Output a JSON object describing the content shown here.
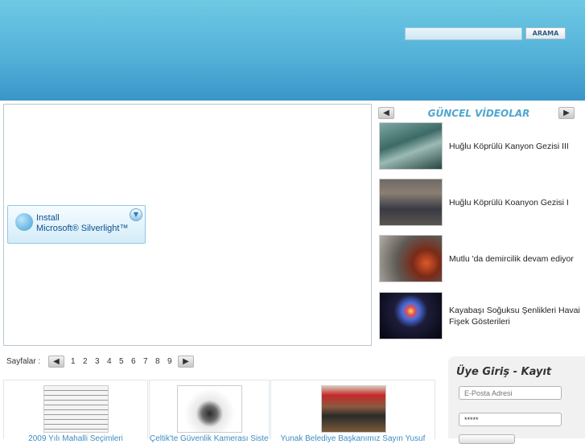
{
  "search": {
    "placeholder": "",
    "button_label": "ARAMA"
  },
  "player": {
    "install_line1": "Install",
    "install_line2": "Microsoft® Silverlight™"
  },
  "videos": {
    "title": "GÜNCEL VİDEOLAR",
    "items": [
      {
        "label": "Huğlu Köprülü Kanyon Gezisi III"
      },
      {
        "label": "Huğlu Köprülü Koanyon Gezisi I"
      },
      {
        "label": "Mutlu 'da demircilik devam ediyor"
      },
      {
        "label": "Kayabaşı Soğuksu Şenlikleri Havai Fişek Gösterileri"
      }
    ]
  },
  "pager": {
    "label": "Sayfalar :",
    "pages": [
      "1",
      "2",
      "3",
      "4",
      "5",
      "6",
      "7",
      "8",
      "9"
    ]
  },
  "news": [
    {
      "caption": "2009 Yılı Mahalli Seçimleri"
    },
    {
      "caption": "Çeltik'te Güvenlik Kamerası Sistemi"
    },
    {
      "caption": "Yunak Belediye Başkanımız Sayın Yusuf"
    }
  ],
  "login": {
    "title": "Üye Giriş - Kayıt",
    "email_placeholder": "E-Posta Adresi",
    "password_value": "*****"
  },
  "colors": {
    "header_top": "#6ec9e3",
    "header_bottom": "#3a95c8",
    "accent_title": "#4fa7cf",
    "link": "#3c8ec2"
  }
}
